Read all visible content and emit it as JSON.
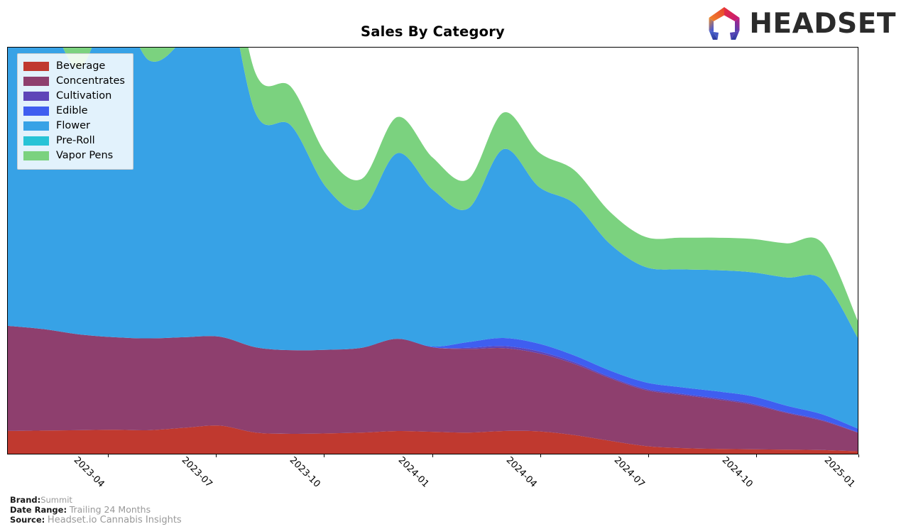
{
  "header": {
    "title": "Sales By Category",
    "logo_text": "HEADSET",
    "logo_icon": "headset-hexagon-logo"
  },
  "footer": {
    "rows": [
      {
        "key": "Brand:",
        "value": "Summit"
      },
      {
        "key": "Date Range:",
        "value": "Trailing 24 Months"
      },
      {
        "key": "Source:",
        "value": "Headset.io Cannabis Insights"
      }
    ]
  },
  "legend": {
    "position": "upper-left",
    "entries": [
      {
        "label": "Beverage",
        "color": "#c0392f"
      },
      {
        "label": "Concentrates",
        "color": "#8e3f6e"
      },
      {
        "label": "Cultivation",
        "color": "#5e45b8"
      },
      {
        "label": "Edible",
        "color": "#3f5ef0"
      },
      {
        "label": "Flower",
        "color": "#37a2e6"
      },
      {
        "label": "Pre-Roll",
        "color": "#27c3d6"
      },
      {
        "label": "Vapor Pens",
        "color": "#7bd27f"
      }
    ]
  },
  "chart_data": {
    "type": "area",
    "stacked": true,
    "title": "Sales By Category",
    "xlabel": "",
    "ylabel": "",
    "grid": false,
    "legend_position": "upper-left",
    "x_tick_labels": [
      "2023-04",
      "2023-07",
      "2023-10",
      "2024-01",
      "2024-04",
      "2024-07",
      "2024-10",
      "2025-01"
    ],
    "x_tick_positions": [
      0.1183,
      0.2452,
      0.3722,
      0.4992,
      0.6261,
      0.7531,
      0.8801,
      1.0
    ],
    "x": [
      "2023-01",
      "2023-02",
      "2023-03",
      "2023-04",
      "2023-05",
      "2023-06",
      "2023-07",
      "2023-08",
      "2023-09",
      "2023-10",
      "2023-11",
      "2023-12",
      "2024-01",
      "2024-02",
      "2024-03",
      "2024-04",
      "2024-05",
      "2024-06",
      "2024-07",
      "2024-08",
      "2024-09",
      "2024-10",
      "2024-11",
      "2024-12",
      "2025-01"
    ],
    "ylim": [
      0,
      100
    ],
    "series": [
      {
        "name": "Beverage",
        "color": "#c0392f",
        "values": [
          5.6,
          5.7,
          5.8,
          5.9,
          5.8,
          6.4,
          6.9,
          5.2,
          4.9,
          5.0,
          5.2,
          5.6,
          5.4,
          5.2,
          5.6,
          5.5,
          4.6,
          3.2,
          1.9,
          1.4,
          1.2,
          1.1,
          1.0,
          0.9,
          0.6
        ]
      },
      {
        "name": "Concentrates",
        "color": "#8e3f6e",
        "values": [
          25.9,
          25.0,
          23.6,
          22.8,
          22.6,
          22.3,
          21.9,
          21.0,
          20.6,
          20.6,
          20.9,
          22.7,
          20.8,
          20.6,
          20.4,
          19.2,
          17.5,
          15.4,
          13.8,
          13.1,
          12.2,
          11.0,
          9.0,
          7.2,
          4.6
        ]
      },
      {
        "name": "Cultivation",
        "color": "#5e45b8",
        "values": [
          0.0,
          0.0,
          0.0,
          0.0,
          0.0,
          0.0,
          0.0,
          0.0,
          0.0,
          0.0,
          0.0,
          0.0,
          0.0,
          0.3,
          0.5,
          0.5,
          0.4,
          0.3,
          0.3,
          0.3,
          0.3,
          0.3,
          0.2,
          0.2,
          0.1
        ]
      },
      {
        "name": "Edible",
        "color": "#3f5ef0",
        "values": [
          0.0,
          0.0,
          0.0,
          0.0,
          0.0,
          0.0,
          0.0,
          0.0,
          0.0,
          0.0,
          0.0,
          0.0,
          0.2,
          1.4,
          2.0,
          1.9,
          1.7,
          1.6,
          1.6,
          1.6,
          1.7,
          1.8,
          1.6,
          1.4,
          0.9
        ]
      },
      {
        "name": "Flower",
        "color": "#37a2e6",
        "values": [
          71.5,
          78.0,
          65.5,
          82.3,
          68.4,
          74.2,
          89.6,
          57.6,
          55.3,
          39.9,
          34.2,
          45.7,
          38.6,
          32.9,
          46.5,
          38.6,
          37.4,
          31.2,
          28.4,
          29.0,
          29.8,
          30.5,
          31.6,
          33.2,
          22.4
        ]
      },
      {
        "name": "Pre-Roll",
        "color": "#27c3d6",
        "values": [
          0.0,
          0.0,
          0.0,
          0.0,
          0.0,
          0.0,
          0.0,
          0.0,
          0.0,
          0.0,
          0.0,
          0.0,
          0.0,
          0.0,
          0.0,
          0.0,
          0.0,
          0.0,
          0.0,
          0.0,
          0.0,
          0.0,
          0.0,
          0.0,
          0.0
        ]
      },
      {
        "name": "Vapor Pens",
        "color": "#7bd27f",
        "values": [
          10.8,
          12.0,
          10.6,
          12.5,
          11.4,
          11.0,
          12.2,
          9.8,
          9.5,
          8.1,
          7.4,
          8.9,
          7.9,
          7.2,
          9.0,
          8.5,
          8.2,
          7.9,
          7.4,
          7.8,
          8.0,
          8.2,
          8.4,
          9.0,
          4.2
        ]
      }
    ]
  }
}
